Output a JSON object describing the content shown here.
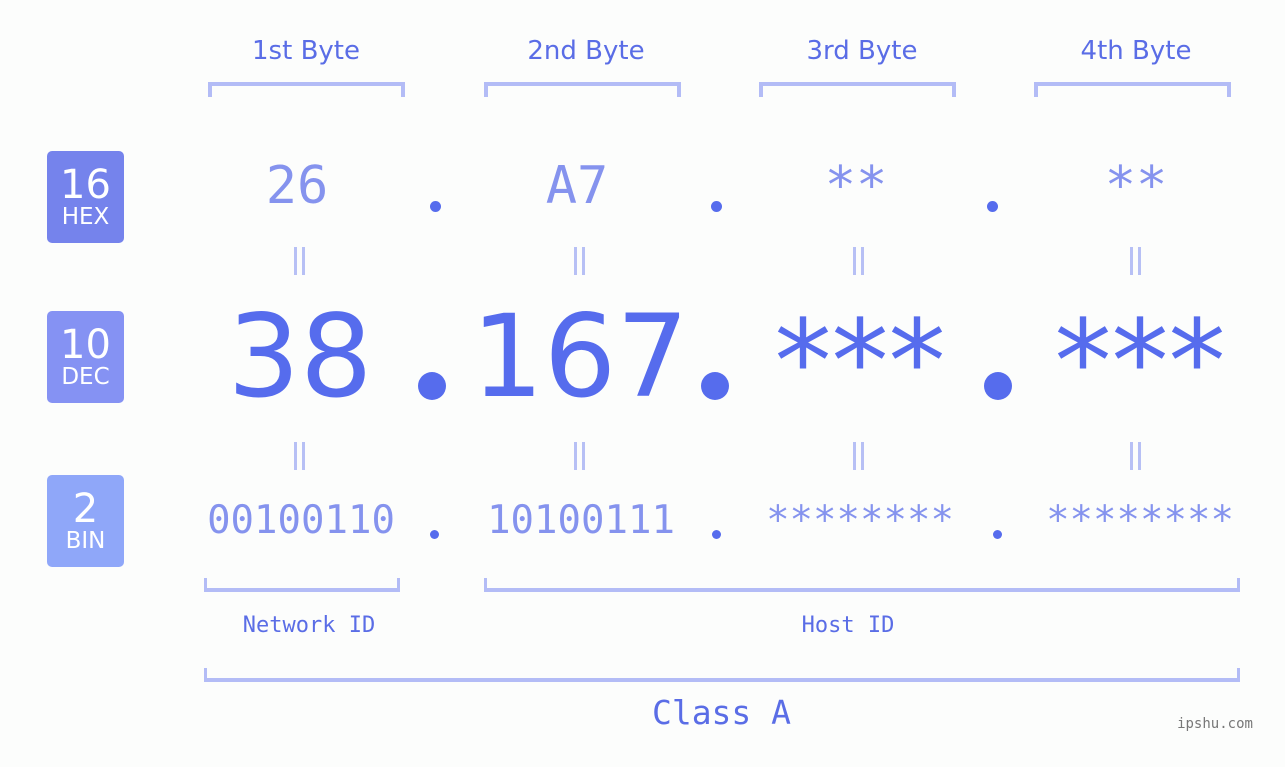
{
  "colors": {
    "hex_badge": "#7583ec",
    "dec_badge": "#8592f3",
    "bin_badge": "#8fa7f9",
    "accent": "#566ced",
    "light_value": "#8593ee",
    "bracket": "#b3bcf6"
  },
  "badges": [
    {
      "base": "16",
      "label": "HEX"
    },
    {
      "base": "10",
      "label": "DEC"
    },
    {
      "base": "2",
      "label": "BIN"
    }
  ],
  "bytes": [
    {
      "label": "1st Byte",
      "hex": "26",
      "dec": "38",
      "bin": "00100110"
    },
    {
      "label": "2nd Byte",
      "hex": "A7",
      "dec": "167",
      "bin": "10100111"
    },
    {
      "label": "3rd Byte",
      "hex": "**",
      "dec": "***",
      "bin": "********"
    },
    {
      "label": "4th Byte",
      "hex": "**",
      "dec": "***",
      "bin": "********"
    }
  ],
  "equals_symbol": "=",
  "network_id_label": "Network ID",
  "host_id_label": "Host ID",
  "class_label": "Class A",
  "watermark": "ipshu.com"
}
